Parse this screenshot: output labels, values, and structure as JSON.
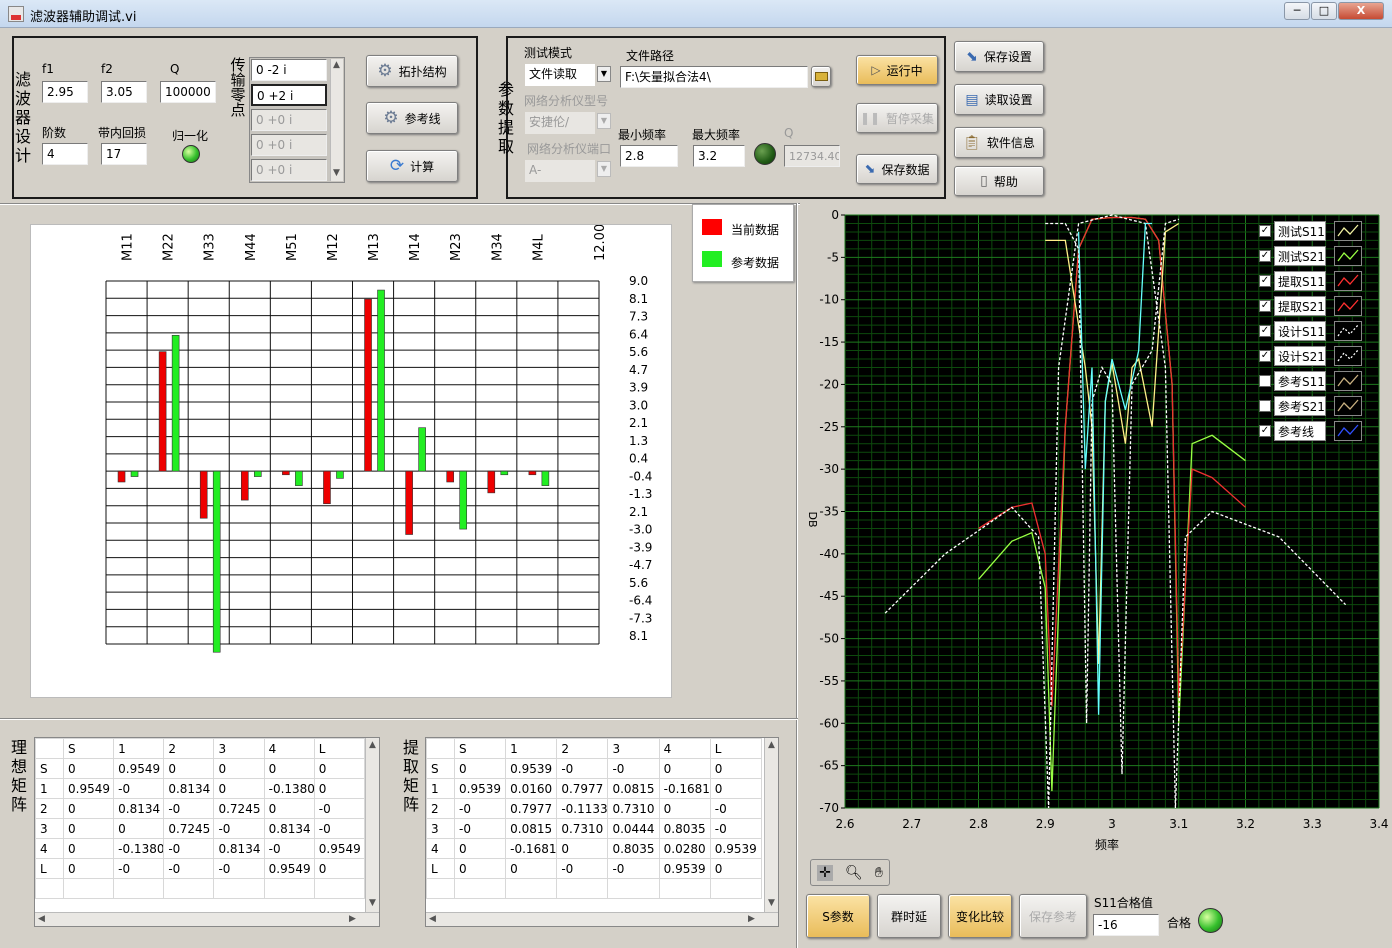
{
  "window": {
    "title": "滤波器辅助调试.vi",
    "min_label": "─",
    "max_label": "□",
    "close_label": "X"
  },
  "design": {
    "group_label": "滤波器设计",
    "f1_label": "f1",
    "f1_value": "2.95",
    "f2_label": "f2",
    "f2_value": "3.05",
    "q_label": "Q",
    "q_value": "100000",
    "order_label": "阶数",
    "order_value": "4",
    "return_loss_label": "带内回损",
    "return_loss_value": "17",
    "normalize_label": "归一化",
    "zeros_label": "传输零点",
    "zeros": [
      "0 -2 i",
      "0 +2 i",
      "0 +0 i",
      "0 +0 i",
      "0 +0 i"
    ],
    "btn_topology": "拓扑结构",
    "btn_refline": "参考线",
    "btn_calc": "计算"
  },
  "extract": {
    "group_label": "参数提取",
    "mode_label": "测试模式",
    "mode_value": "文件读取",
    "path_label": "文件路径",
    "path_value": "F:\\矢量拟合法4\\",
    "vna_model_label": "网络分析仪型号",
    "vna_model_value": "安捷伦/",
    "vna_port_label": "网络分析仪端口",
    "vna_port_value": "A-",
    "fmin_label": "最小频率",
    "fmin_value": "2.8",
    "fmax_label": "最大频率",
    "fmax_value": "3.2",
    "q_label": "Q",
    "q_value": "12734.40",
    "btn_run": "运行中",
    "btn_pause": "暂停采集",
    "btn_save_data": "保存数据"
  },
  "side_buttons": {
    "save_settings": "保存设置",
    "load_settings": "读取设置",
    "software_info": "软件信息",
    "help": "帮助"
  },
  "bar_legend": {
    "current": "当前数据",
    "reference": "参考数据",
    "current_color": "#ff0000",
    "reference_color": "#22ee22"
  },
  "bar_chart": {
    "type": "bar",
    "categories": [
      "M11",
      "M22",
      "M33",
      "M44",
      "M51",
      "M12",
      "M13",
      "M14",
      "M23",
      "M34",
      "M4L",
      "12.000"
    ],
    "right_ticks": [
      "9.0",
      "8.1",
      "7.3",
      "6.4",
      "5.6",
      "4.7",
      "3.9",
      "3.0",
      "2.1",
      "1.3",
      "0.4",
      "-0.4",
      "-1.3",
      "2.1",
      "-3.0",
      "-3.9",
      "-4.7",
      "5.6",
      "-6.4",
      "-7.3",
      "8.1"
    ],
    "series": [
      {
        "name": "当前数据",
        "color": "#ee0000",
        "values": [
          -0.6,
          6.6,
          -2.6,
          -1.6,
          -0.2,
          -1.8,
          9.5,
          -3.5,
          -0.6,
          -1.2,
          -0.2
        ]
      },
      {
        "name": "参考数据",
        "color": "#22ee22",
        "values": [
          -0.3,
          7.5,
          -10.0,
          -0.3,
          -0.8,
          -0.4,
          10.0,
          2.4,
          -3.2,
          -0.2,
          -0.8
        ]
      }
    ]
  },
  "ideal_matrix": {
    "label": "理想矩阵",
    "rows": [
      [
        "",
        "S",
        "1",
        "2",
        "3",
        "4",
        "L"
      ],
      [
        "S",
        "0",
        "0.9549",
        "0",
        "0",
        "0",
        "0"
      ],
      [
        "1",
        "0.9549",
        "-0",
        "0.8134",
        "0",
        "-0.1380",
        "0"
      ],
      [
        "2",
        "0",
        "0.8134",
        "-0",
        "0.7245",
        "0",
        "-0"
      ],
      [
        "3",
        "0",
        "0",
        "0.7245",
        "-0",
        "0.8134",
        "-0"
      ],
      [
        "4",
        "0",
        "-0.1380",
        "-0",
        "0.8134",
        "-0",
        "0.9549"
      ],
      [
        "L",
        "0",
        "-0",
        "-0",
        "-0",
        "0.9549",
        "0"
      ],
      [
        "",
        "",
        "",
        "",
        "",
        "",
        ""
      ]
    ]
  },
  "extract_matrix": {
    "label": "提取矩阵",
    "rows": [
      [
        "",
        "S",
        "1",
        "2",
        "3",
        "4",
        "L"
      ],
      [
        "S",
        "0",
        "0.9539",
        "-0",
        "-0",
        "0",
        "0"
      ],
      [
        "1",
        "0.9539",
        "0.0160",
        "0.7977",
        "0.0815",
        "-0.1681",
        "0"
      ],
      [
        "2",
        "-0",
        "0.7977",
        "-0.1133",
        "0.7310",
        "0",
        "-0"
      ],
      [
        "3",
        "-0",
        "0.0815",
        "0.7310",
        "0.0444",
        "0.8035",
        "-0"
      ],
      [
        "4",
        "0",
        "-0.1681",
        "0",
        "0.8035",
        "0.0280",
        "0.9539"
      ],
      [
        "L",
        "0",
        "0",
        "-0",
        "-0",
        "0.9539",
        "0"
      ],
      [
        "",
        "",
        "",
        "",
        "",
        "",
        ""
      ]
    ]
  },
  "s_chart": {
    "type": "line",
    "ylabel": "DB",
    "xlabel": "频率",
    "xlim": [
      2.6,
      3.4
    ],
    "ylim": [
      -70,
      0
    ],
    "x_ticks": [
      "2.6",
      "2.7",
      "2.8",
      "2.9",
      "3",
      "3.1",
      "3.2",
      "3.3",
      "3.4"
    ],
    "y_ticks": [
      "0",
      "-5",
      "-10",
      "-15",
      "-20",
      "-25",
      "-30",
      "-35",
      "-40",
      "-45",
      "-50",
      "-55",
      "-60",
      "-65",
      "-70"
    ],
    "grid": true,
    "legend_position": "top-right",
    "legend": [
      {
        "name": "测试S11",
        "checked": true,
        "color": "#f0f0a0"
      },
      {
        "name": "测试S21",
        "checked": true,
        "color": "#99ff44"
      },
      {
        "name": "提取S11",
        "checked": true,
        "color": "#ff3030"
      },
      {
        "name": "提取S21",
        "checked": true,
        "color": "#ff3030"
      },
      {
        "name": "设计S11",
        "checked": true,
        "color": "#ffffff"
      },
      {
        "name": "设计S21",
        "checked": true,
        "color": "#ffffff"
      },
      {
        "name": "参考S11",
        "checked": false,
        "color": "#c8b080"
      },
      {
        "name": "参考S21",
        "checked": false,
        "color": "#c8b080"
      },
      {
        "name": "参考线",
        "checked": true,
        "color": "#3050ff"
      }
    ],
    "series": [
      {
        "name": "测试S21",
        "color": "#99ff44",
        "x": [
          2.8,
          2.85,
          2.88,
          2.9,
          2.91,
          2.93,
          2.95,
          2.97,
          3.0,
          3.03,
          3.05,
          3.07,
          3.09,
          3.1,
          3.12,
          3.15,
          3.2
        ],
        "y": [
          -43,
          -38.5,
          -37.5,
          -44,
          -68,
          -25,
          -4,
          -0.5,
          -0.3,
          -0.3,
          -0.5,
          -3,
          -20,
          -60,
          -27,
          -26,
          -29
        ]
      },
      {
        "name": "提取S21",
        "color": "#ee3030",
        "x": [
          2.8,
          2.85,
          2.88,
          2.9,
          2.91,
          2.93,
          2.95,
          2.97,
          3.0,
          3.03,
          3.05,
          3.07,
          3.09,
          3.1,
          3.12,
          3.15,
          3.2
        ],
        "y": [
          -37,
          -34.5,
          -34,
          -40,
          -58,
          -25,
          -4,
          -0.5,
          -0.3,
          -0.3,
          -0.5,
          -3,
          -20,
          -57,
          -30,
          -31,
          -34.5
        ]
      },
      {
        "name": "测试S11",
        "color": "#ffee88",
        "x": [
          2.9,
          2.93,
          2.95,
          2.96,
          2.97,
          2.98,
          2.99,
          3.0,
          3.02,
          3.03,
          3.04,
          3.06,
          3.08,
          3.1
        ],
        "y": [
          -3,
          -3,
          -13,
          -18,
          -25,
          -53,
          -22,
          -17.5,
          -27,
          -18,
          -17,
          -25,
          -2,
          -1
        ]
      },
      {
        "name": "设计S11",
        "color": "#ffffff",
        "x": [
          2.9,
          2.93,
          2.95,
          2.962,
          2.97,
          2.985,
          3.0,
          3.015,
          3.03,
          3.045,
          3.06,
          3.08,
          3.1
        ],
        "y": [
          -1,
          -1,
          -4,
          -60,
          -22,
          -18,
          -20,
          -66,
          -20,
          -18,
          -16,
          -1,
          -0.5
        ]
      },
      {
        "name": "设计S21",
        "color": "#ffffff",
        "x": [
          2.66,
          2.75,
          2.85,
          2.89,
          2.905,
          2.92,
          2.95,
          3.0,
          3.05,
          3.08,
          3.095,
          3.11,
          3.15,
          3.25,
          3.35
        ],
        "y": [
          -47,
          -40,
          -34.5,
          -38,
          -70,
          -18,
          -1,
          0,
          -1,
          -18,
          -70,
          -38,
          -35,
          -38,
          -46
        ]
      },
      {
        "name": "参考线",
        "color": "#66ffff",
        "x": [
          2.95,
          2.96,
          2.97,
          2.98,
          2.99,
          3.0,
          3.02,
          3.04,
          3.05,
          3.06
        ],
        "y": [
          -2,
          -30,
          -18,
          -59,
          -22,
          -17,
          -23,
          -16,
          -1,
          -1
        ]
      }
    ]
  },
  "bottom": {
    "btn_s_params": "S参数",
    "btn_group_delay": "群时延",
    "btn_change_compare": "变化比较",
    "btn_save_ref": "保存参考",
    "s11_label": "S11合格值",
    "s11_value": "-16",
    "pass_label": "合格"
  }
}
